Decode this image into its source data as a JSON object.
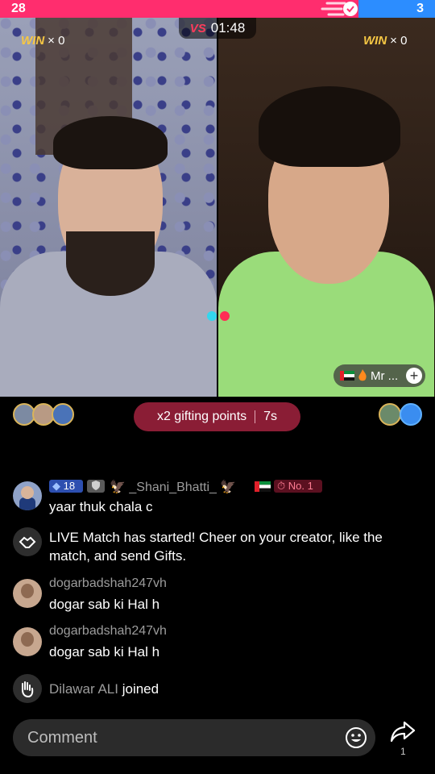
{
  "score": {
    "left": "28",
    "right": "3",
    "left_fraction": 0.824,
    "left_color": "#ff2d6e",
    "right_color": "#2c8dff"
  },
  "battle": {
    "timer": "01:48",
    "vs_label": "VS",
    "left_win_label": "WIN",
    "left_win_count": "× 0",
    "right_win_label": "WIN",
    "right_win_count": "× 0"
  },
  "host_chip": {
    "label": "Mr ...",
    "flag": "uae-flag",
    "extra_icon": "fire-icon",
    "action_icon": "plus-icon"
  },
  "gifting": {
    "label": "x2 gifting points",
    "time_left": "7s"
  },
  "chat": [
    {
      "type": "comment",
      "level": "18",
      "username": "_Shani_Bhatti_",
      "rank": "No. 1",
      "message": "yaar thuk chala c"
    },
    {
      "type": "system",
      "message": "LIVE Match has started! Cheer on your creator, like the match, and send Gifts."
    },
    {
      "type": "comment",
      "username": "dogarbadshah247vh",
      "message": "dogar sab ki Hal h"
    },
    {
      "type": "comment",
      "username": "dogarbadshah247vh",
      "message": "dogar sab ki Hal h"
    },
    {
      "type": "join",
      "username": "Dilawar ALI",
      "action": "joined"
    }
  ],
  "bottom": {
    "comment_placeholder": "Comment",
    "share_count": "1"
  }
}
